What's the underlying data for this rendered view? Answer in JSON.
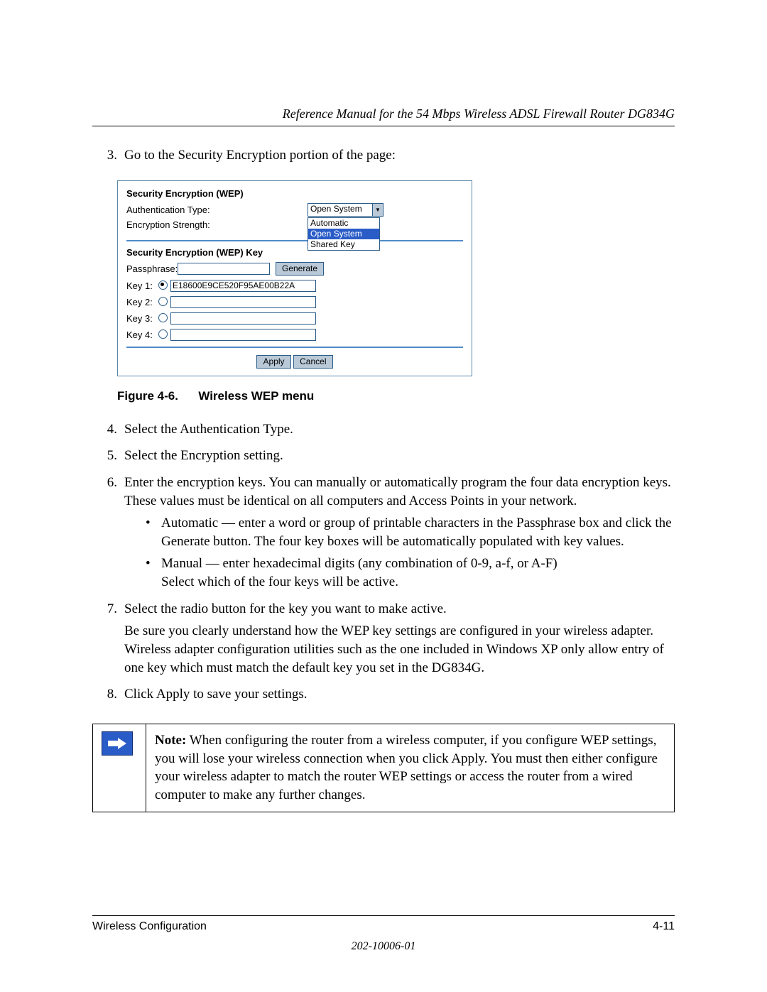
{
  "header": {
    "title": "Reference Manual for the 54 Mbps Wireless ADSL Firewall Router DG834G"
  },
  "steps": {
    "s3": {
      "num": "3.",
      "text": "Go to the Security Encryption portion of the page:"
    },
    "s4": {
      "num": "4.",
      "text": "Select the Authentication Type."
    },
    "s5": {
      "num": "5.",
      "text": "Select the Encryption setting."
    },
    "s6": {
      "num": "6.",
      "text": "Enter the encryption keys. You can manually or automatically program the four data encryption keys. These values must be identical on all computers and Access Points in your network.",
      "b1": "Automatic — enter a word or group of printable characters in the Passphrase box and click the Generate button. The four key boxes will be automatically populated with key values.",
      "b2a": "Manual — enter hexadecimal digits (any combination of 0-9, a-f, or A-F)",
      "b2b": "Select which of the four keys will be active."
    },
    "s7": {
      "num": "7.",
      "p1": "Select the radio button for the key you want to make active.",
      "p2": "Be sure you clearly understand how the WEP key settings are configured in your wireless adapter. Wireless adapter configuration utilities such as the one included in Windows XP only allow entry of one key which must match the default key you set in the DG834G."
    },
    "s8": {
      "num": "8.",
      "text": "Click Apply to save your settings."
    }
  },
  "figure": {
    "caption_prefix": "Figure 4-6.",
    "caption_text": "Wireless WEP menu",
    "title": "Security Encryption (WEP)",
    "auth_label": "Authentication Type:",
    "auth_value": "Open System",
    "enc_label": "Encryption Strength:",
    "dd_items": {
      "a": "Automatic",
      "b": "Open System",
      "c": "Shared Key"
    },
    "key_title": "Security Encryption (WEP) Key",
    "passphrase_label": "Passphrase:",
    "generate": "Generate",
    "key1_label": "Key 1:",
    "key2_label": "Key 2:",
    "key3_label": "Key 3:",
    "key4_label": "Key 4:",
    "key1_value": "E18600E9CE520F95AE00B22A",
    "apply": "Apply",
    "cancel": "Cancel"
  },
  "note": {
    "label": "Note:",
    "text": " When configuring the router from a wireless computer, if you configure WEP settings, you will lose your wireless connection when you click Apply. You must then either configure your wireless adapter to match the router WEP settings or access the router from a wired computer to make any further changes."
  },
  "footer": {
    "left": "Wireless Configuration",
    "right": "4-11",
    "docnum": "202-10006-01"
  }
}
